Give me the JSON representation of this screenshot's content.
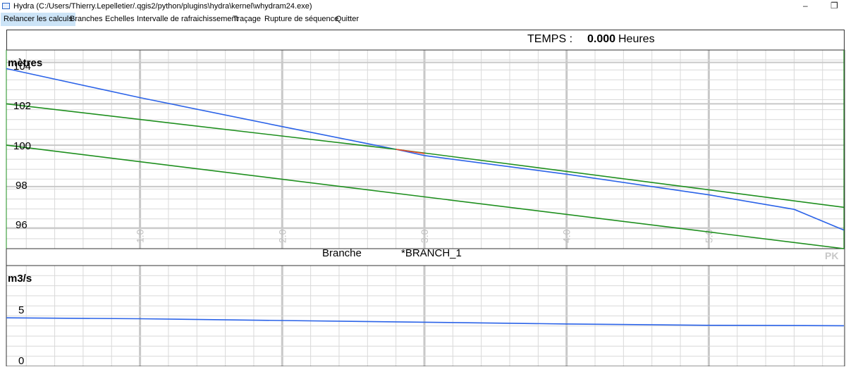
{
  "window": {
    "title": "Hydra  (C:/Users/Thierry.Lepelletier/.qgis2/python/plugins\\hydra\\kernel\\whydram24.exe)",
    "minimize_glyph": "–",
    "restore_glyph": "❐"
  },
  "menu": {
    "items": [
      {
        "label": "Relancer les calculs"
      },
      {
        "label": "Branches"
      },
      {
        "label": "Echelles"
      },
      {
        "label": "Intervalle de rafraichissement"
      },
      {
        "label": "Traçage"
      },
      {
        "label": "Rupture de séquence"
      },
      {
        "label": "Quitter"
      }
    ]
  },
  "header": {
    "time_label": "TEMPS :",
    "time_value": "0.000",
    "time_unit": "Heures"
  },
  "level_chart": {
    "ylabel": "mètres",
    "yticks": [
      "104",
      "102",
      "100",
      "98",
      "96"
    ],
    "xticks": [
      "1.0",
      "2.0",
      "3.0",
      "4.0",
      "5.0"
    ]
  },
  "branch": {
    "label": "Branche",
    "name": "*BRANCH_1"
  },
  "pk_label": "PK",
  "flow_chart": {
    "ylabel": "m3/s",
    "yticks": [
      "5",
      "0"
    ]
  },
  "colors": {
    "water_line": "#2b63e8",
    "bank_line": "#1e8f1e",
    "highlight": "#e84a2b",
    "grid": "#d9d9d9",
    "grid_major": "#c8c8c8"
  },
  "chart_data": [
    {
      "type": "line",
      "title": "",
      "xlabel": "PK",
      "ylabel": "mètres",
      "xlim": [
        0.06,
        5.95
      ],
      "ylim": [
        95.0,
        104.6
      ],
      "x_ticks": [
        1.0,
        2.0,
        3.0,
        4.0,
        5.0
      ],
      "y_ticks": [
        96,
        98,
        100,
        102,
        104
      ],
      "grid": true,
      "series": [
        {
          "color": "#2b63e8",
          "x": [
            0.06,
            1.0,
            2.0,
            2.8,
            3.0,
            4.0,
            5.0,
            5.6,
            5.95
          ],
          "values": [
            103.7,
            102.3,
            100.9,
            99.8,
            99.5,
            98.6,
            97.6,
            96.9,
            95.9
          ]
        },
        {
          "color": "#1e8f1e",
          "x": [
            0.06,
            2.8,
            5.95
          ],
          "values": [
            102.0,
            99.8,
            97.0
          ]
        },
        {
          "color": "#1e8f1e",
          "x": [
            0.06,
            5.95
          ],
          "values": [
            100.0,
            95.0
          ]
        },
        {
          "color": "#e84a2b",
          "x": [
            2.8,
            3.0
          ],
          "values": [
            99.8,
            99.6
          ]
        }
      ]
    },
    {
      "type": "line",
      "title": "",
      "xlabel": "",
      "ylabel": "m3/s",
      "xlim": [
        0.06,
        5.95
      ],
      "ylim": [
        0,
        8
      ],
      "y_ticks": [
        0,
        5
      ],
      "grid": true,
      "series": [
        {
          "color": "#2b63e8",
          "x": [
            0.06,
            1.0,
            2.0,
            3.0,
            4.0,
            5.0,
            5.95
          ],
          "values": [
            4.9,
            4.8,
            4.6,
            4.4,
            4.2,
            4.05,
            4.0
          ]
        }
      ]
    }
  ]
}
